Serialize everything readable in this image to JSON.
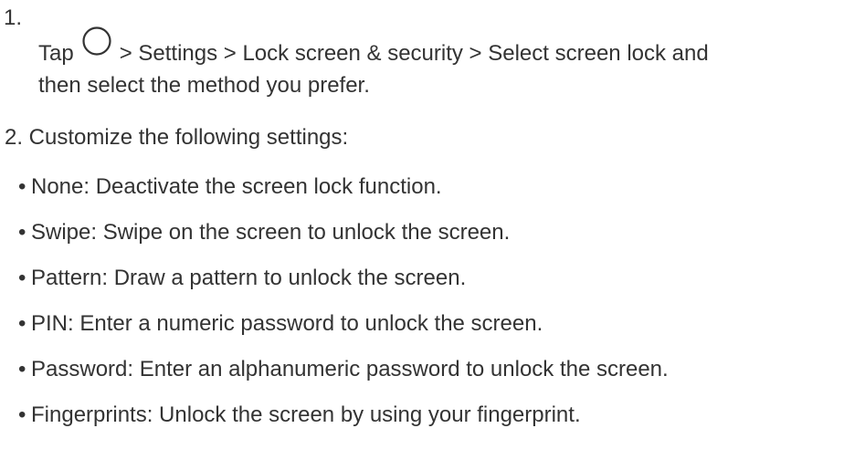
{
  "step1": {
    "number": "1.",
    "prefix": "Tap",
    "icon": "home-circle-icon",
    "path_text": "> Settings > Lock screen & security > Select screen lock and",
    "continuation": "then select the method you prefer."
  },
  "step2": {
    "text": "2. Customize the following settings:"
  },
  "bullet_char": "•",
  "options": [
    {
      "text": "None: Deactivate the screen lock function."
    },
    {
      "text": "Swipe: Swipe on the screen to unlock the screen."
    },
    {
      "text": "Pattern: Draw a pattern to unlock the screen."
    },
    {
      "text": "PIN: Enter a numeric password to unlock the screen."
    },
    {
      "text": "Password: Enter an alphanumeric password to unlock the screen."
    },
    {
      "text": "Fingerprints: Unlock the screen by using your fingerprint."
    }
  ]
}
